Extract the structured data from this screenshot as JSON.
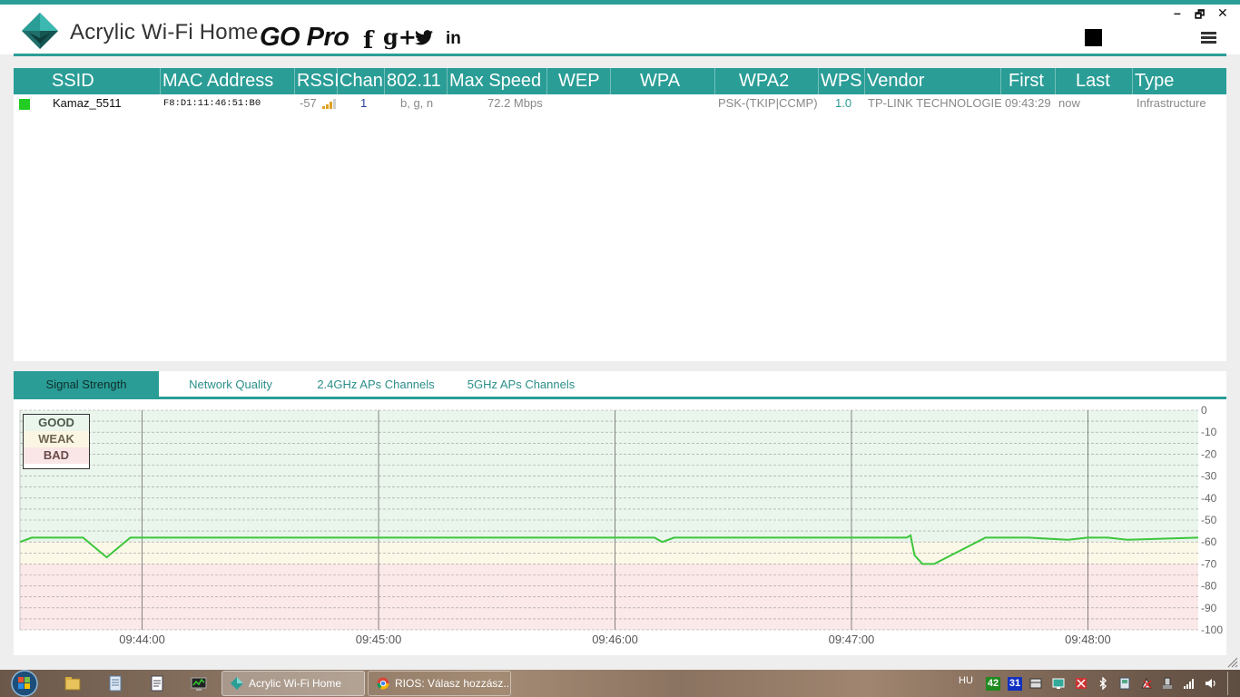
{
  "app": {
    "title": "Acrylic Wi-Fi Home",
    "go_pro": "GO Pro",
    "social": {
      "facebook": "f",
      "googleplus": "g+",
      "twitter": "twitter-icon",
      "linkedin": "in"
    },
    "window_controls": {
      "minimize": "–",
      "maximize": "🗗",
      "close": "✕"
    }
  },
  "table": {
    "columns": [
      "SSID",
      "MAC Address",
      "RSSI",
      "Chan",
      "802.11",
      "Max Speed",
      "WEP",
      "WPA",
      "WPA2",
      "WPS",
      "Vendor",
      "First",
      "Last",
      "Type"
    ],
    "rows": [
      {
        "color": "#22cc22",
        "ssid": "Kamaz_5511",
        "mac": "F8:D1:11:46:51:B0",
        "rssi": "-57",
        "chan": "1",
        "standards": "b, g, n",
        "max_speed": "72.2 Mbps",
        "wep": "",
        "wpa": "",
        "wpa2": "PSK-(TKIP|CCMP)",
        "wps": "1.0",
        "vendor": "TP-LINK TECHNOLOGIE",
        "first": "09:43:29",
        "last": "now",
        "type": "Infrastructure"
      }
    ]
  },
  "tabs": {
    "items": [
      "Signal Strength",
      "Network Quality",
      "2.4GHz APs Channels",
      "5GHz APs Channels"
    ],
    "active": "Signal Strength"
  },
  "legend": {
    "good": "GOOD",
    "weak": "WEAK",
    "bad": "BAD"
  },
  "chart_data": {
    "type": "line",
    "title": "",
    "xlabel": "",
    "ylabel": "",
    "ylim": [
      -100,
      0
    ],
    "y_ticks": [
      "0",
      "-10",
      "-20",
      "-30",
      "-40",
      "-50",
      "-60",
      "-70",
      "-80",
      "-90",
      "-100"
    ],
    "x_ticks": [
      "09:44:00",
      "09:45:00",
      "09:46:00",
      "09:47:00",
      "09:48:00"
    ],
    "x_range_seconds": [
      "09:43:29",
      "09:48:28"
    ],
    "grid": true,
    "zones": {
      "good": [
        -60,
        0
      ],
      "weak": [
        -70,
        -60
      ],
      "bad": [
        -100,
        -70
      ]
    },
    "series": [
      {
        "name": "",
        "color": "#3cc63c",
        "x": [
          "09:43:29",
          "09:43:32",
          "09:43:45",
          "09:43:51",
          "09:43:55",
          "09:43:57",
          "09:43:57",
          "09:44:30",
          "09:45:00",
          "09:46:00",
          "09:46:10",
          "09:46:12",
          "09:46:15",
          "09:46:30",
          "09:47:00",
          "09:47:09",
          "09:47:14",
          "09:47:15",
          "09:47:16",
          "09:47:18",
          "09:47:20",
          "09:47:21",
          "09:47:34",
          "09:47:45",
          "09:47:55",
          "09:48:00",
          "09:48:05",
          "09:48:10",
          "09:48:28"
        ],
        "values": [
          -60,
          -58,
          -58,
          -67,
          -61,
          -58,
          -58,
          -58,
          -58,
          -58,
          -58,
          -60,
          -58,
          -58,
          -58,
          -58,
          -58,
          -57,
          -66,
          -70,
          -70,
          -70,
          -58,
          -58,
          -59,
          -58,
          -58,
          -59,
          -58
        ]
      }
    ]
  },
  "taskbar": {
    "tasks": [
      {
        "label": "Acrylic Wi-Fi Home",
        "active": true
      },
      {
        "label": "RIOS: Válasz hozzász...",
        "active": false
      }
    ],
    "lang": "HU",
    "badges": [
      {
        "text": "42",
        "color": "#1f8a1f"
      },
      {
        "text": "31",
        "color": "#1030c0"
      }
    ]
  }
}
